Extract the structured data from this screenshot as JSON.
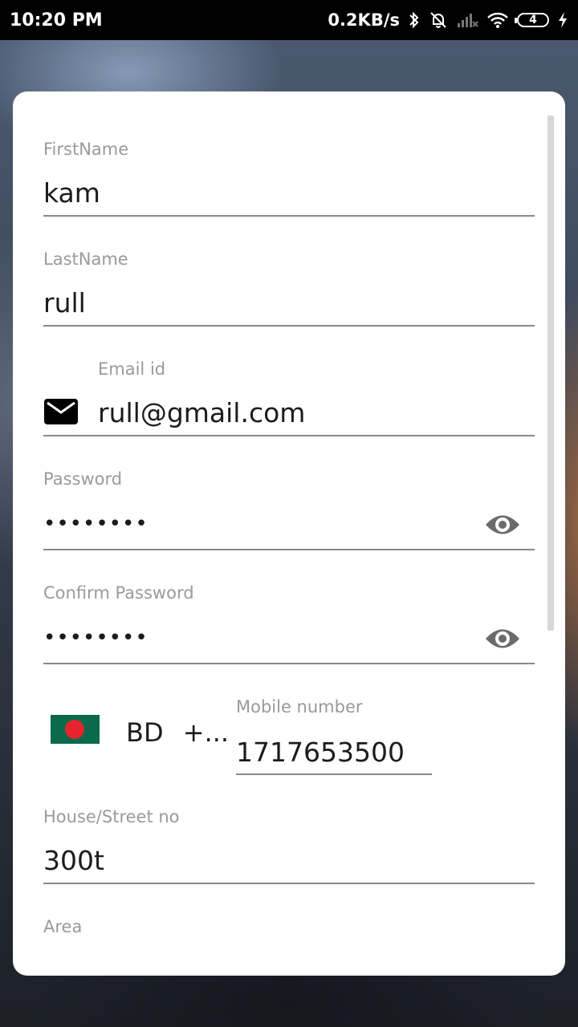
{
  "status_bar": {
    "time": "10:20 PM",
    "speed": "0.2KB/s",
    "battery": "4"
  },
  "form": {
    "first_name": {
      "label": "FirstName",
      "value": "kam"
    },
    "last_name": {
      "label": "LastName",
      "value": "rull"
    },
    "email": {
      "label": "Email id",
      "value": "rull@gmail.com"
    },
    "password": {
      "label": "Password",
      "value": "••••••••"
    },
    "confirm_password": {
      "label": "Confirm Password",
      "value": "••••••••"
    },
    "phone": {
      "country": "BD",
      "code": "+...",
      "label": "Mobile number",
      "value": "1717653500"
    },
    "house_street": {
      "label": "House/Street no",
      "value": "300t"
    },
    "area": {
      "label": "Area",
      "value": ""
    }
  },
  "icons": {
    "email": "mail-icon",
    "password_toggle": "eye-icon",
    "country_flag": "bangladesh-flag-icon"
  },
  "colors": {
    "card_background": "#ffffff",
    "label": "#9a9a9a",
    "text": "#1c1c1c",
    "underline": "#8a8a8a",
    "flag_green": "#0b6a4b",
    "flag_red": "#e52430"
  }
}
